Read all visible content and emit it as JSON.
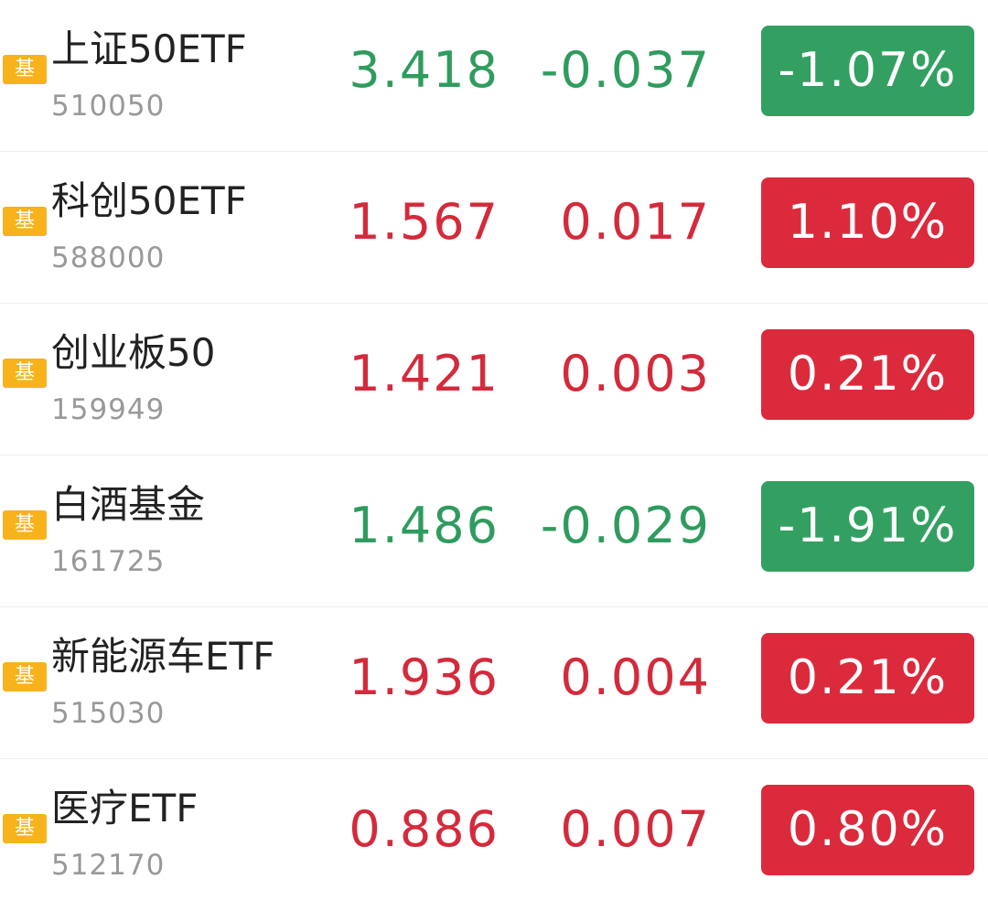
{
  "colors": {
    "up": "#dc2a3d",
    "down": "#33a062",
    "badge": "#f7b21c"
  },
  "rows": [
    {
      "badge": "基",
      "name": "上证50ETF",
      "code": "510050",
      "price": "3.418",
      "change": "-0.037",
      "pct": "-1.07%",
      "direction": "down"
    },
    {
      "badge": "基",
      "name": "科创50ETF",
      "code": "588000",
      "price": "1.567",
      "change": "0.017",
      "pct": "1.10%",
      "direction": "up"
    },
    {
      "badge": "基",
      "name": "创业板50",
      "code": "159949",
      "price": "1.421",
      "change": "0.003",
      "pct": "0.21%",
      "direction": "up"
    },
    {
      "badge": "基",
      "name": "白酒基金",
      "code": "161725",
      "price": "1.486",
      "change": "-0.029",
      "pct": "-1.91%",
      "direction": "down"
    },
    {
      "badge": "基",
      "name": "新能源车ETF",
      "code": "515030",
      "price": "1.936",
      "change": "0.004",
      "pct": "0.21%",
      "direction": "up"
    },
    {
      "badge": "基",
      "name": "医疗ETF",
      "code": "512170",
      "price": "0.886",
      "change": "0.007",
      "pct": "0.80%",
      "direction": "up"
    }
  ]
}
